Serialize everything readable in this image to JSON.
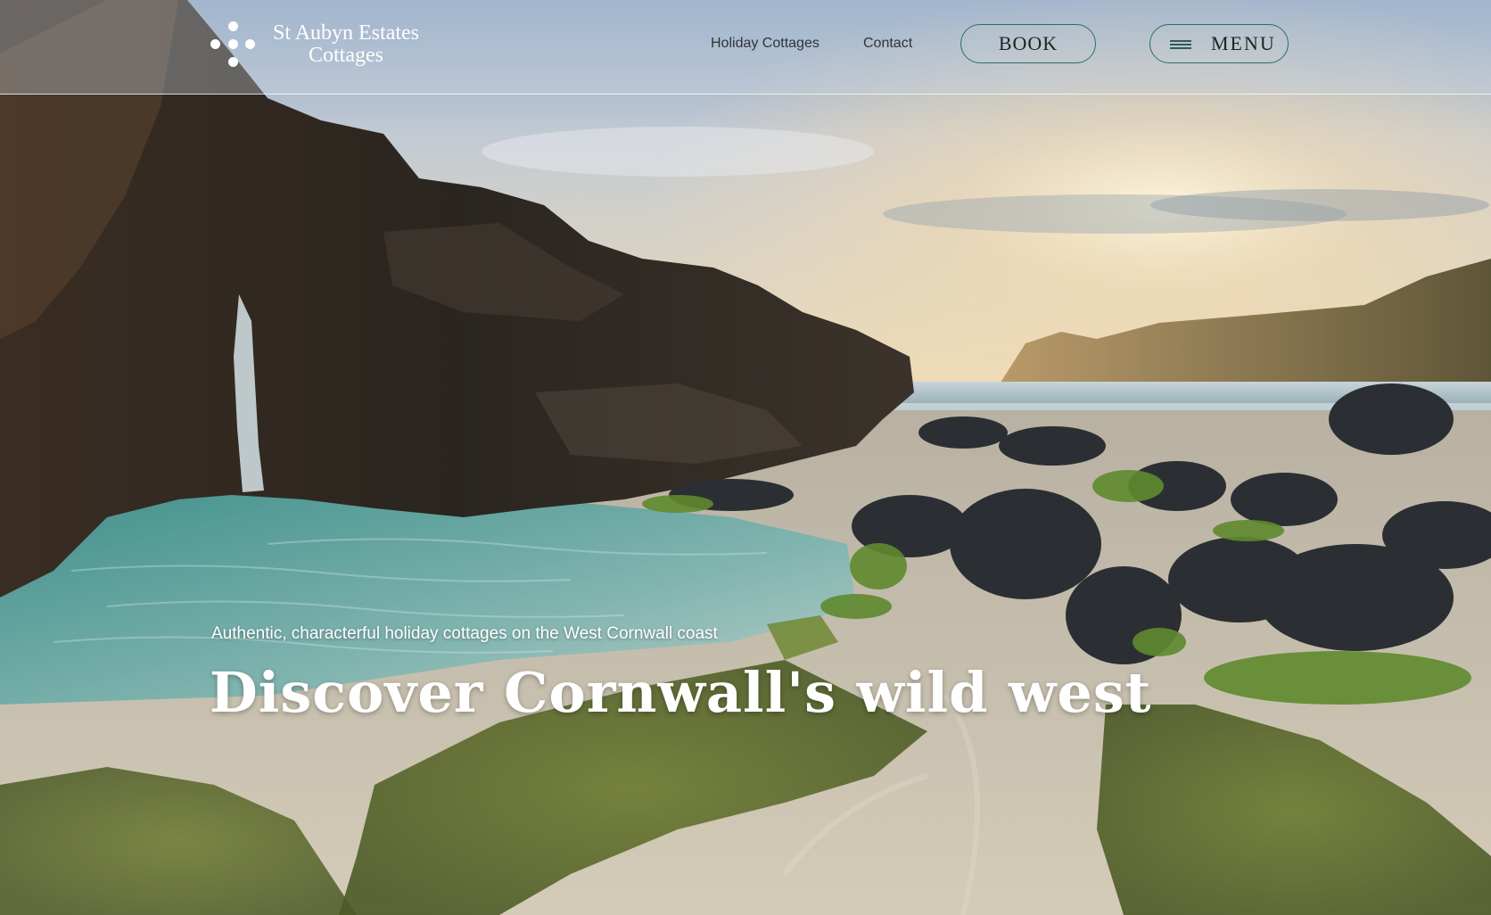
{
  "brand": {
    "name_line1": "St Aubyn Estates",
    "name_line2": "Cottages",
    "logo_icon": "dot-cluster-logo-icon"
  },
  "nav": {
    "links": [
      {
        "label": "Holiday Cottages"
      },
      {
        "label": "Contact"
      }
    ],
    "book_label": "BOOK",
    "menu_label": "MENU",
    "menu_icon": "hamburger-icon"
  },
  "hero": {
    "tagline": "Authentic, characterful holiday cottages on the West Cornwall coast",
    "headline": "Discover Cornwall's wild west",
    "image_subject": "rocky beach cove with sea arch at sunset"
  },
  "colors": {
    "accent": "#2c6e64",
    "text_dark": "#1e2326",
    "text_light": "#ffffff"
  }
}
